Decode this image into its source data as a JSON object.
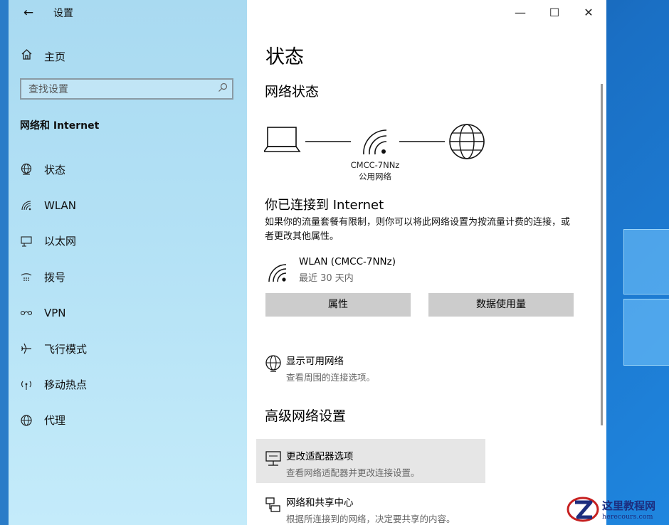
{
  "window": {
    "app_title": "设置",
    "minimize": "—",
    "maximize": "☐",
    "close": "✕"
  },
  "sidebar": {
    "home_label": "主页",
    "search_placeholder": "查找设置",
    "section_title": "网络和 Internet",
    "items": [
      {
        "label": "状态",
        "icon": "status-globe-icon"
      },
      {
        "label": "WLAN",
        "icon": "wifi-icon"
      },
      {
        "label": "以太网",
        "icon": "ethernet-icon"
      },
      {
        "label": "拨号",
        "icon": "dialup-icon"
      },
      {
        "label": "VPN",
        "icon": "vpn-icon"
      },
      {
        "label": "飞行模式",
        "icon": "airplane-icon"
      },
      {
        "label": "移动热点",
        "icon": "hotspot-icon"
      },
      {
        "label": "代理",
        "icon": "proxy-globe-icon"
      }
    ]
  },
  "main": {
    "page_title": "状态",
    "network_status_title": "网络状态",
    "network_name": "CMCC-7NNz",
    "network_type": "公用网络",
    "connected_title": "你已连接到 Internet",
    "connected_desc": "如果你的流量套餐有限制，则你可以将此网络设置为按流量计费的连接，或者更改其他属性。",
    "connection": {
      "name": "WLAN (CMCC-7NNz)",
      "sub": "最近 30 天内"
    },
    "buttons": {
      "properties": "属性",
      "data_usage": "数据使用量"
    },
    "show_networks": {
      "title": "显示可用网络",
      "desc": "查看周围的连接选项。"
    },
    "advanced_title": "高级网络设置",
    "adapter_options": {
      "title": "更改适配器选项",
      "desc": "查看网络适配器并更改连接设置。"
    },
    "sharing_center": {
      "title": "网络和共享中心",
      "desc": "根据所连接到的网络，决定要共享的内容。"
    }
  },
  "watermark": {
    "title": "这里教程网",
    "url": "herecours.com"
  },
  "colors": {
    "sidebar_bg": "#b3e1f5",
    "button_bg": "#cccccc",
    "highlight_bg": "#e6e6e6",
    "desktop": "#1a6fc4"
  }
}
